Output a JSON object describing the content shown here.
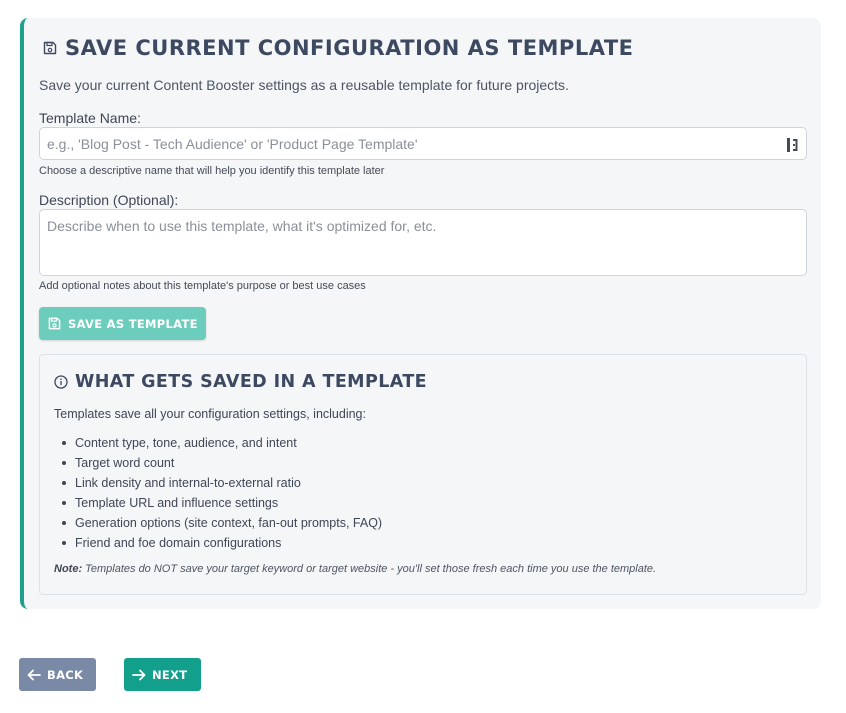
{
  "panel": {
    "title": "Save Current Configuration as Template",
    "intro": "Save your current Content Booster settings as a reusable template for future projects."
  },
  "template_name": {
    "label": "Template Name:",
    "value": "",
    "placeholder": "e.g., 'Blog Post - Tech Audience' or 'Product Page Template'",
    "helper": "Choose a descriptive name that will help you identify this template later"
  },
  "description": {
    "label": "Description (Optional):",
    "value": "",
    "placeholder": "Describe when to use this template, what it's optimized for, etc.",
    "helper": "Add optional notes about this template's purpose or best use cases"
  },
  "save_button": {
    "label": "Save as Template"
  },
  "info": {
    "title": "What Gets Saved in a Template",
    "intro": "Templates save all your configuration settings, including:",
    "items": [
      "Content type, tone, audience, and intent",
      "Target word count",
      "Link density and internal-to-external ratio",
      "Template URL and influence settings",
      "Generation options (site context, fan-out prompts, FAQ)",
      "Friend and foe domain configurations"
    ],
    "note_label": "Note:",
    "note_text": " Templates do NOT save your target keyword or target website - you'll set those fresh each time you use the template."
  },
  "nav": {
    "back_label": "Back",
    "next_label": "Next"
  },
  "colors": {
    "accent": "#1fa08c",
    "save_button": "#6ccdbd",
    "back_button": "#7989a6",
    "next_button": "#12a08c",
    "title_text": "#3d4961"
  },
  "icons": {
    "title": "floppy-disk-icon",
    "field": "password-manager-icon",
    "save": "floppy-disk-icon",
    "info": "info-circle-icon",
    "back": "arrow-left-icon",
    "next": "arrow-right-icon"
  }
}
